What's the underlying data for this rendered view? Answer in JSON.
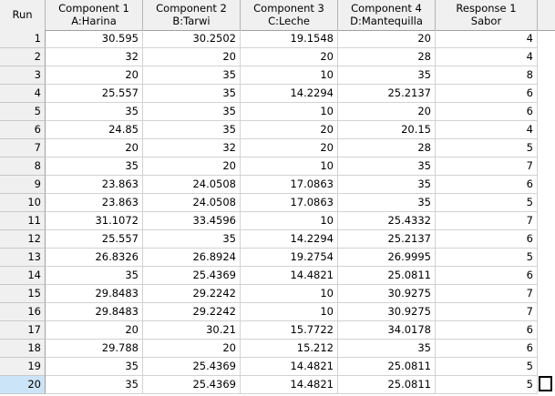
{
  "headers": [
    {
      "line1": "Run",
      "line2": ""
    },
    {
      "line1": "Component 1",
      "line2": "A:Harina"
    },
    {
      "line1": "Component 2",
      "line2": "B:Tarwi"
    },
    {
      "line1": "Component 3",
      "line2": "C:Leche"
    },
    {
      "line1": "Component 4",
      "line2": "D:Mantequilla"
    },
    {
      "line1": "Response 1",
      "line2": "Sabor"
    }
  ],
  "rows": [
    [
      "1",
      "30.595",
      "30.2502",
      "19.1548",
      "20",
      "4"
    ],
    [
      "2",
      "32",
      "20",
      "20",
      "28",
      "4"
    ],
    [
      "3",
      "20",
      "35",
      "10",
      "35",
      "8"
    ],
    [
      "4",
      "25.557",
      "35",
      "14.2294",
      "25.2137",
      "6"
    ],
    [
      "5",
      "35",
      "35",
      "10",
      "20",
      "6"
    ],
    [
      "6",
      "24.85",
      "35",
      "20",
      "20.15",
      "4"
    ],
    [
      "7",
      "20",
      "32",
      "20",
      "28",
      "5"
    ],
    [
      "8",
      "35",
      "20",
      "10",
      "35",
      "7"
    ],
    [
      "9",
      "23.863",
      "24.0508",
      "17.0863",
      "35",
      "6"
    ],
    [
      "10",
      "23.863",
      "24.0508",
      "17.0863",
      "35",
      "5"
    ],
    [
      "11",
      "31.1072",
      "33.4596",
      "10",
      "25.4332",
      "7"
    ],
    [
      "12",
      "25.557",
      "35",
      "14.2294",
      "25.2137",
      "6"
    ],
    [
      "13",
      "26.8326",
      "26.8924",
      "19.2754",
      "26.9995",
      "5"
    ],
    [
      "14",
      "35",
      "25.4369",
      "14.4821",
      "25.0811",
      "6"
    ],
    [
      "15",
      "29.8483",
      "29.2242",
      "10",
      "30.9275",
      "7"
    ],
    [
      "16",
      "29.8483",
      "29.2242",
      "10",
      "30.9275",
      "7"
    ],
    [
      "17",
      "20",
      "30.21",
      "15.7722",
      "34.0178",
      "6"
    ],
    [
      "18",
      "29.788",
      "20",
      "15.212",
      "35",
      "6"
    ],
    [
      "19",
      "35",
      "25.4369",
      "14.4821",
      "25.0811",
      "5"
    ],
    [
      "20",
      "35",
      "25.4369",
      "14.4821",
      "25.0811",
      "5"
    ]
  ],
  "selected_row": "20"
}
